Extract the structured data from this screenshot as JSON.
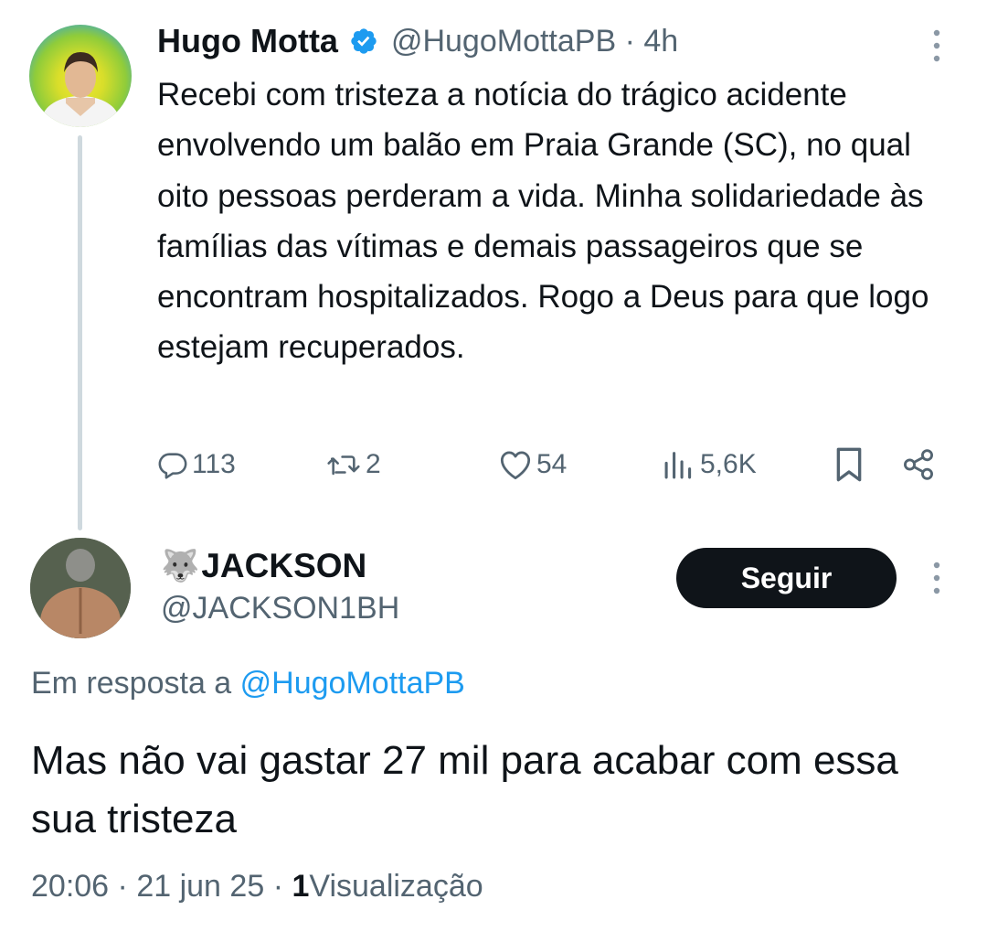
{
  "parent_tweet": {
    "name": "Hugo Motta",
    "verified_icon": "verified-badge-icon",
    "handle": "@HugoMottaPB",
    "separator": "·",
    "time": "4h",
    "text": "Recebi com tristeza a notícia do trágico acidente envolvendo um balão em Praia Grande (SC), no qual oito pessoas perderam a vida. Minha solidariedade às famílias das vítimas e demais passageiros que se encontram hospitalizados. Rogo a Deus para que logo estejam recuperados.",
    "actions": {
      "replies": "113",
      "reposts": "2",
      "likes": "54",
      "views": "5,6K"
    }
  },
  "reply_tweet": {
    "emoji": "🐺",
    "name": "JACKSON",
    "handle": "@JACKSON1BH",
    "follow_label": "Seguir",
    "reply_to_prefix": "Em resposta a",
    "reply_to_handle": "@HugoMottaPB",
    "text": "Mas não vai gastar 27 mil para acabar com essa sua tristeza",
    "time": "20:06",
    "separator": "·",
    "date": "21 jun 25",
    "views_count": "1",
    "views_label": "Visualização"
  },
  "colors": {
    "text": "#0f1419",
    "secondary": "#536471",
    "link": "#1d9bf0",
    "thread_line": "#cfd9de",
    "button_bg": "#0f1419"
  }
}
